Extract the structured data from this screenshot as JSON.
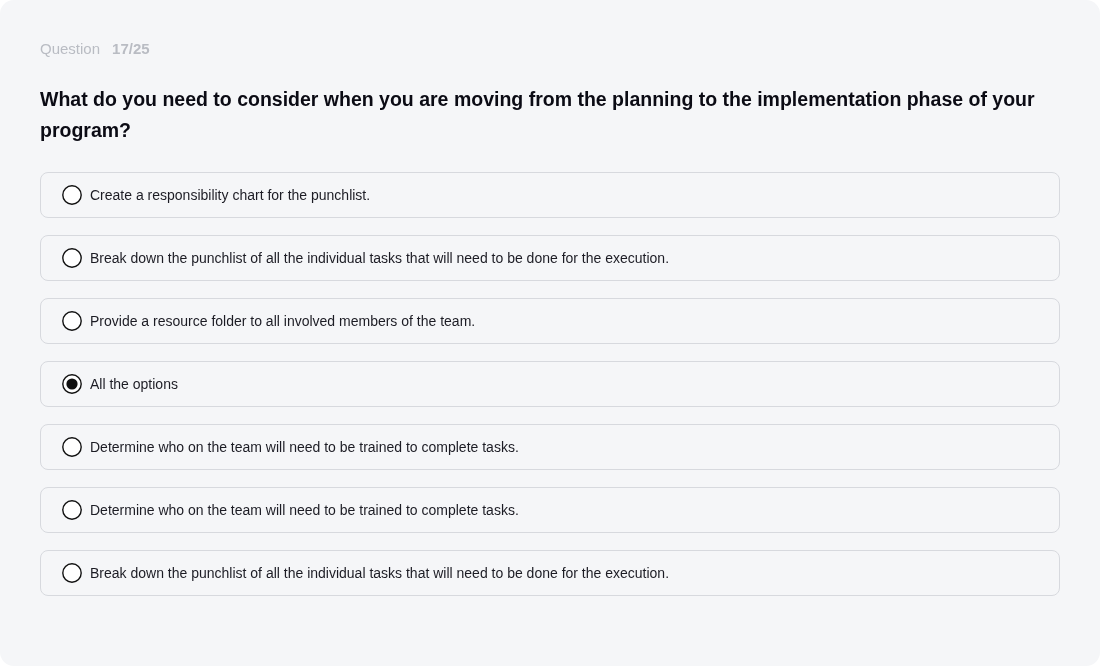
{
  "progress": {
    "label": "Question",
    "count": "17/25"
  },
  "question": "What do you need to consider when you are moving from the planning to the implementation phase of your program?",
  "options": [
    {
      "text": "Create a responsibility chart for the punchlist.",
      "selected": false
    },
    {
      "text": "Break down the punchlist of all the individual tasks that will need to be done for the execution.",
      "selected": false
    },
    {
      "text": "Provide a resource folder to all involved members of the team.",
      "selected": false
    },
    {
      "text": "All the options",
      "selected": true
    },
    {
      "text": "Determine who on the team will need to be trained to complete tasks.",
      "selected": false
    },
    {
      "text": "Determine who on the team will need to be trained to complete tasks.",
      "selected": false
    },
    {
      "text": "Break down the punchlist of all the individual tasks that will need to be done for the execution.",
      "selected": false
    }
  ]
}
